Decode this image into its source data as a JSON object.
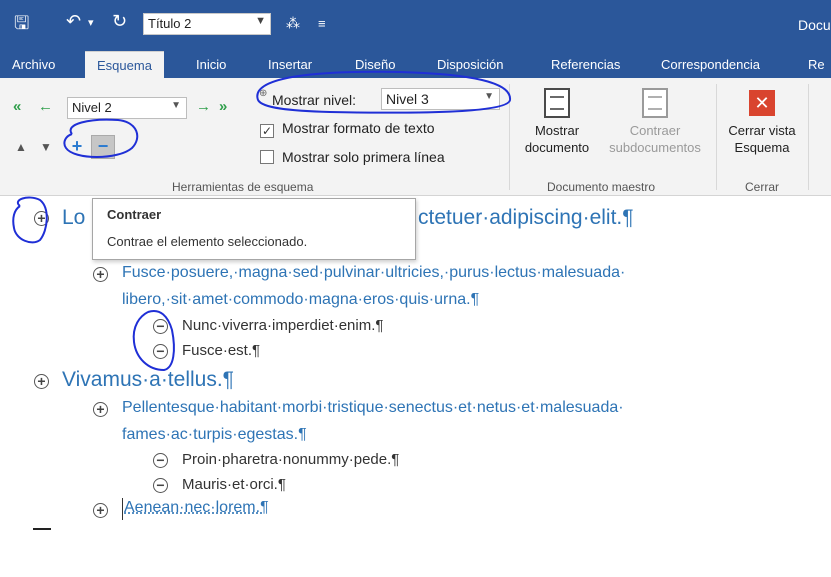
{
  "titlebar": {
    "save_icon": "save-icon",
    "undo_icon": "undo-icon",
    "redo_icon": "redo-icon",
    "style_value": "Título 2",
    "doc_title": "Docu"
  },
  "tabs": [
    {
      "label": "Archivo"
    },
    {
      "label": "Esquema",
      "active": true
    },
    {
      "label": "Inicio"
    },
    {
      "label": "Insertar"
    },
    {
      "label": "Diseño"
    },
    {
      "label": "Disposición"
    },
    {
      "label": "Referencias"
    },
    {
      "label": "Correspondencia"
    },
    {
      "label": "Re"
    }
  ],
  "ribbon": {
    "outline_tools": {
      "level_value": "Nivel 2",
      "group_label": "Herramientas de esquema"
    },
    "show_level": {
      "label": "Mostrar nivel:",
      "value": "Nivel 3"
    },
    "show_text_format": {
      "label": "Mostrar formato de texto",
      "checked": true
    },
    "show_first_line": {
      "label": "Mostrar solo primera línea",
      "checked": false
    },
    "master_doc": {
      "show_doc_line1": "Mostrar",
      "show_doc_line2": "documento",
      "collapse_sub_line1": "Contraer",
      "collapse_sub_line2": "subdocumentos",
      "group_label": "Documento maestro"
    },
    "close": {
      "button_line1": "Cerrar vista",
      "button_line2": "Esquema",
      "group_label": "Cerrar"
    }
  },
  "tooltip": {
    "title": "Contraer",
    "body": "Contrae el elemento seleccionado."
  },
  "document": {
    "lines": [
      {
        "level": 1,
        "symbol": "plus",
        "text": "Lo"
      },
      {
        "level": 1,
        "symbol": "none",
        "text": "ctetuer·adipiscing·elit.¶"
      },
      {
        "level": 2,
        "symbol": "plus",
        "text": "Fusce·posuere,·magna·sed·pulvinar·ultricies,·purus·lectus·malesuada·"
      },
      {
        "level": 2,
        "symbol": "none",
        "text": "libero,·sit·amet·commodo·magna·eros·quis·urna.¶"
      },
      {
        "level": 3,
        "symbol": "minus",
        "text": "Nunc·viverra·imperdiet·enim.¶"
      },
      {
        "level": 3,
        "symbol": "minus",
        "text": "Fusce·est.¶"
      },
      {
        "level": 1,
        "symbol": "plus",
        "text": "Vivamus·a·tellus.¶"
      },
      {
        "level": 2,
        "symbol": "plus",
        "text": "Pellentesque·habitant·morbi·tristique·senectus·et·netus·et·malesuada·"
      },
      {
        "level": 2,
        "symbol": "none",
        "text": "fames·ac·turpis·egestas.¶"
      },
      {
        "level": 3,
        "symbol": "minus",
        "text": "Proin·pharetra·nonummy·pede.¶"
      },
      {
        "level": 3,
        "symbol": "minus",
        "text": "Mauris·et·orci.¶"
      },
      {
        "level": 2,
        "symbol": "plus",
        "text": "Aenean·nec·lorem.¶"
      }
    ]
  },
  "colors": {
    "brand": "#2b579a",
    "heading_blue": "#2e74b5",
    "annotation": "#1f2fd6"
  }
}
